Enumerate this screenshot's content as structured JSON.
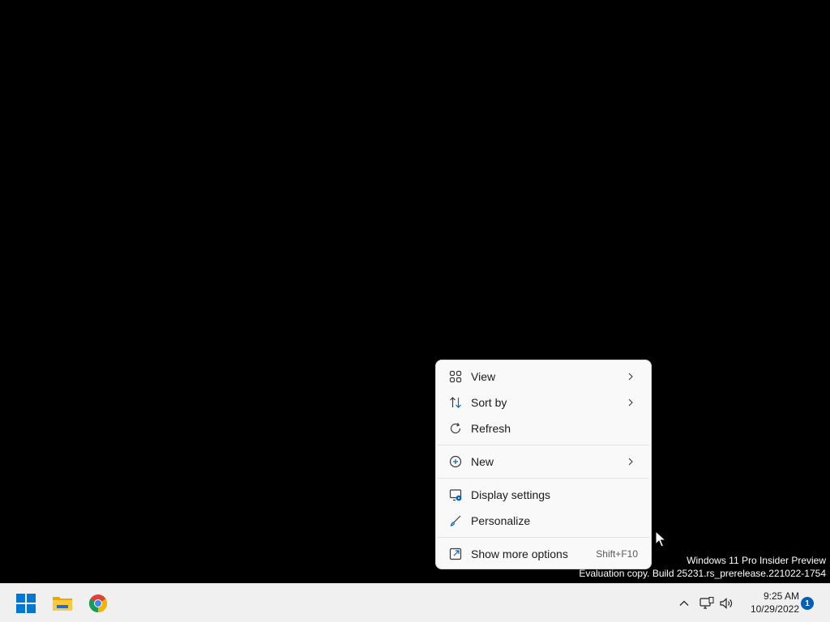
{
  "context_menu": {
    "items": [
      {
        "label": "View",
        "icon": "grid-icon",
        "has_submenu": true
      },
      {
        "label": "Sort by",
        "icon": "sort-icon",
        "has_submenu": true
      },
      {
        "label": "Refresh",
        "icon": "refresh-icon",
        "has_submenu": false
      },
      {
        "label": "New",
        "icon": "plus-circle-icon",
        "has_submenu": true
      },
      {
        "label": "Display settings",
        "icon": "display-settings-icon",
        "has_submenu": false
      },
      {
        "label": "Personalize",
        "icon": "brush-icon",
        "has_submenu": false
      },
      {
        "label": "Show more options",
        "icon": "show-more-icon",
        "shortcut": "Shift+F10"
      }
    ]
  },
  "watermark": {
    "line1": "Windows 11 Pro Insider Preview",
    "line2": "Evaluation copy. Build 25231.rs_prerelease.221022-1754"
  },
  "taskbar": {
    "apps": [
      {
        "name": "Start",
        "icon": "windows-start-icon"
      },
      {
        "name": "File Explorer",
        "icon": "file-explorer-icon"
      },
      {
        "name": "Google Chrome",
        "icon": "chrome-icon"
      }
    ],
    "tray": {
      "icons": [
        "chevron-up-icon",
        "network-icon",
        "volume-icon"
      ],
      "time": "9:25 AM",
      "date": "10/29/2022",
      "notification_count": "1"
    }
  },
  "colors": {
    "desktop_bg": "#000000",
    "menu_bg": "#f9f9f9",
    "taskbar_bg": "#f0f0f0",
    "accent": "#005fb8",
    "icon_blue": "#0067c0"
  }
}
